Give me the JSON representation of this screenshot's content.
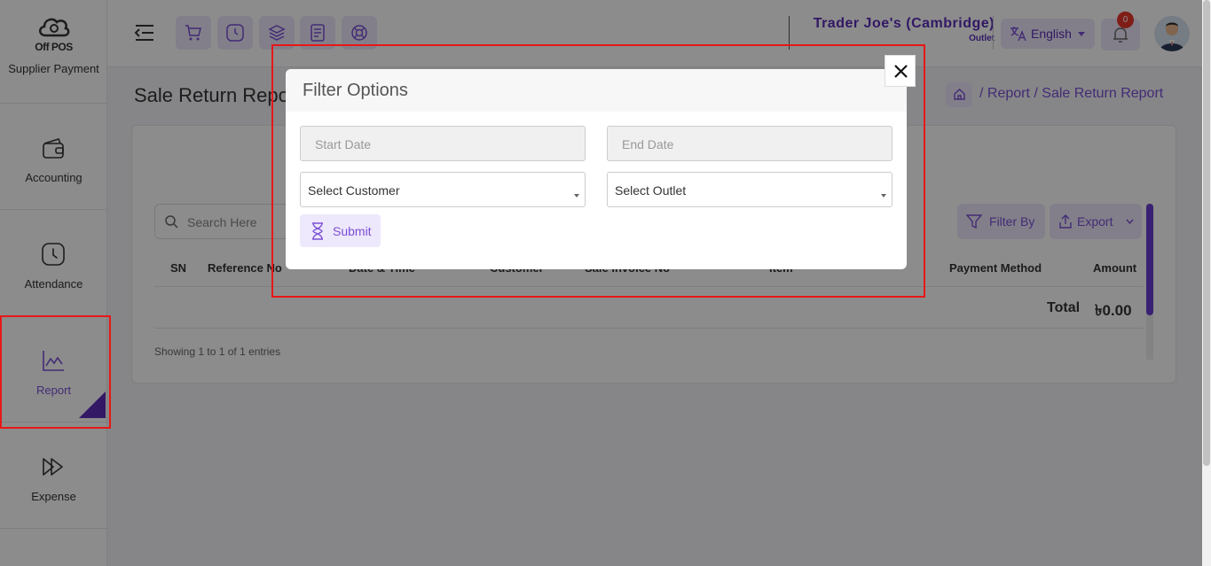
{
  "logo": {
    "text": "Off POS"
  },
  "sidebar": {
    "clipped_item": "Supplier Payment",
    "items": [
      {
        "label": "Accounting",
        "icon": "wallet-icon"
      },
      {
        "label": "Attendance",
        "icon": "clock-icon"
      },
      {
        "label": "Report",
        "icon": "chart-icon",
        "active": true
      },
      {
        "label": "Expense",
        "icon": "expense-icon"
      }
    ]
  },
  "topbar": {
    "quick_icons": [
      "cart-icon",
      "clock-icon",
      "layers-icon",
      "receipt-icon",
      "life-ring-icon"
    ],
    "store_name": "Trader Joe's (Cambridge)",
    "store_sub": "Outlet",
    "language": "English",
    "notification_count": "0"
  },
  "page": {
    "title": "Sale Return Report",
    "breadcrumb": [
      "Report",
      "Sale Return Report"
    ],
    "search_placeholder": "Search Here",
    "filter_by": "Filter By",
    "export": "Export",
    "table": {
      "headers": [
        "SN",
        "Reference No",
        "Date & Time",
        "Customer",
        "Sale Invoice No",
        "Item",
        "Payment Method",
        "Amount"
      ],
      "total_label": "Total",
      "total_value": "৳0.00"
    },
    "showing": "Showing 1 to 1 of 1 entries"
  },
  "modal": {
    "title": "Filter Options",
    "start_date_placeholder": "Start Date",
    "end_date_placeholder": "End Date",
    "customer_select": "Select Customer",
    "outlet_select": "Select Outlet",
    "submit": "Submit"
  },
  "colors": {
    "accent": "#7b4fd6",
    "accent_dark": "#5b2db8",
    "highlight": "#e81717",
    "badge": "#e8352b"
  }
}
